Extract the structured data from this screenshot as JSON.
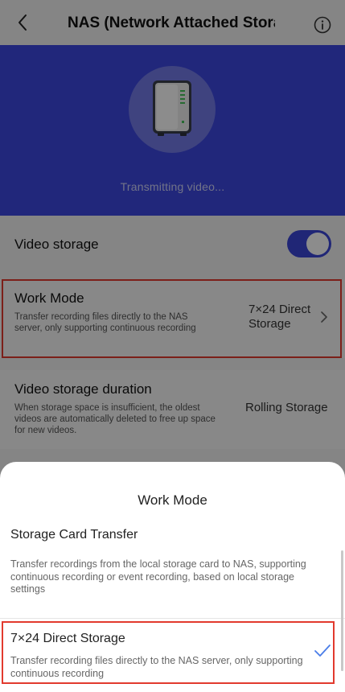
{
  "header": {
    "title": "NAS (Network Attached Storage)",
    "back_icon": "chevron-left-icon",
    "info_icon": "info-circle-icon"
  },
  "hero": {
    "icon": "nas-device-icon",
    "status": "Transmitting video...",
    "background": "#3d47e0"
  },
  "settings": {
    "video_storage": {
      "label": "Video storage",
      "enabled": true
    },
    "work_mode": {
      "label": "Work Mode",
      "description": "Transfer recording files directly to the NAS server, only supporting continuous recording",
      "value": "7×24 Direct Storage"
    },
    "duration": {
      "label": "Video storage duration",
      "description": "When storage space is insufficient, the oldest videos are automatically deleted to free up space for new videos.",
      "value": "Rolling Storage"
    }
  },
  "sheet": {
    "title": "Work Mode",
    "options": [
      {
        "title": "Storage Card Transfer",
        "description": "Transfer recordings from the local storage card to NAS, supporting continuous recording or event recording, based on local storage settings",
        "selected": false
      },
      {
        "title": "7×24 Direct Storage",
        "description": "Transfer recording files directly to the NAS server, only supporting continuous recording",
        "selected": true
      }
    ]
  },
  "colors": {
    "accent": "#3b45d8",
    "highlight": "#e23a2e",
    "check": "#4a7de8"
  }
}
